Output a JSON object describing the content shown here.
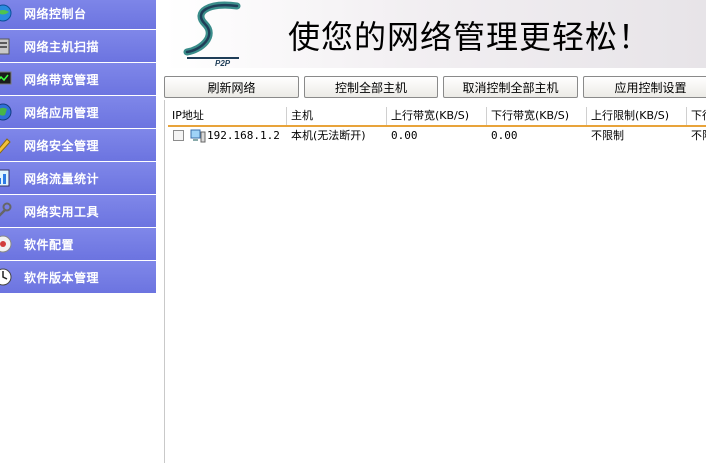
{
  "sidebar": {
    "items": [
      {
        "label": "网络控制台",
        "icon": "globe-icon"
      },
      {
        "label": "网络主机扫描",
        "icon": "server-icon"
      },
      {
        "label": "网络带宽管理",
        "icon": "monitor-icon"
      },
      {
        "label": "网络应用管理",
        "icon": "globe-app-icon"
      },
      {
        "label": "网络安全管理",
        "icon": "pencil-icon"
      },
      {
        "label": "网络流量统计",
        "icon": "chart-icon"
      },
      {
        "label": "网络实用工具",
        "icon": "tools-icon"
      },
      {
        "label": "软件配置",
        "icon": "config-icon"
      },
      {
        "label": "软件版本管理",
        "icon": "version-icon"
      }
    ]
  },
  "banner": {
    "logo_text": "P2P",
    "slogan": "使您的网络管理更轻松！"
  },
  "toolbar": {
    "refresh": "刷新网络",
    "control_all": "控制全部主机",
    "cancel_all": "取消控制全部主机",
    "apply_settings": "应用控制设置"
  },
  "table": {
    "headers": [
      "IP地址",
      "主机",
      "上行带宽(KB/S)",
      "下行带宽(KB/S)",
      "上行限制(KB/S)",
      "下行"
    ],
    "rows": [
      {
        "ip": "192.168.1.2",
        "host": "本机(无法断开)",
        "up": "0.00",
        "down": "0.00",
        "up_limit": "不限制",
        "down_limit": "不限"
      }
    ]
  },
  "colors": {
    "sidebar_bg": "#7079e4",
    "header_accent": "#e8a33a"
  }
}
